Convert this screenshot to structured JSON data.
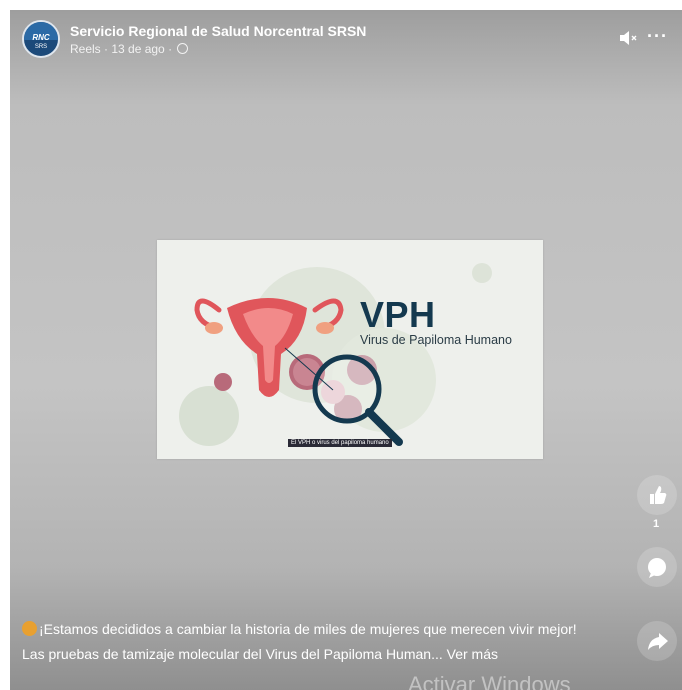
{
  "post": {
    "page_name": "Servicio Regional de Salud Norcentral SRSN",
    "meta": "Reels · 13 de ago ·",
    "avatar_text": "RNC",
    "avatar_sub": "SRS",
    "privacy_icon": "globe-icon"
  },
  "controls": {
    "mute_icon": "speaker-muted-icon",
    "more_label": "···"
  },
  "video": {
    "title": "VPH",
    "subtitle": "Virus de Papiloma Humano",
    "caption": "El VPH o virus del papiloma humano"
  },
  "reactions": {
    "like_count": "1",
    "like_icon": "thumbs-up-icon",
    "comment_icon": "comment-icon",
    "share_icon": "share-icon"
  },
  "text": {
    "line1": "¡Estamos decididos a cambiar la historia de miles de mujeres que merecen vivir mejor!",
    "line2": "Las pruebas de tamizaje molecular del Virus del Papiloma Human...",
    "see_more": "Ver más"
  },
  "watermark": "Activar Windows",
  "colors": {
    "title_color": "#14394f",
    "uterus_color": "#e0565b",
    "cell_color": "#b86a7a"
  }
}
